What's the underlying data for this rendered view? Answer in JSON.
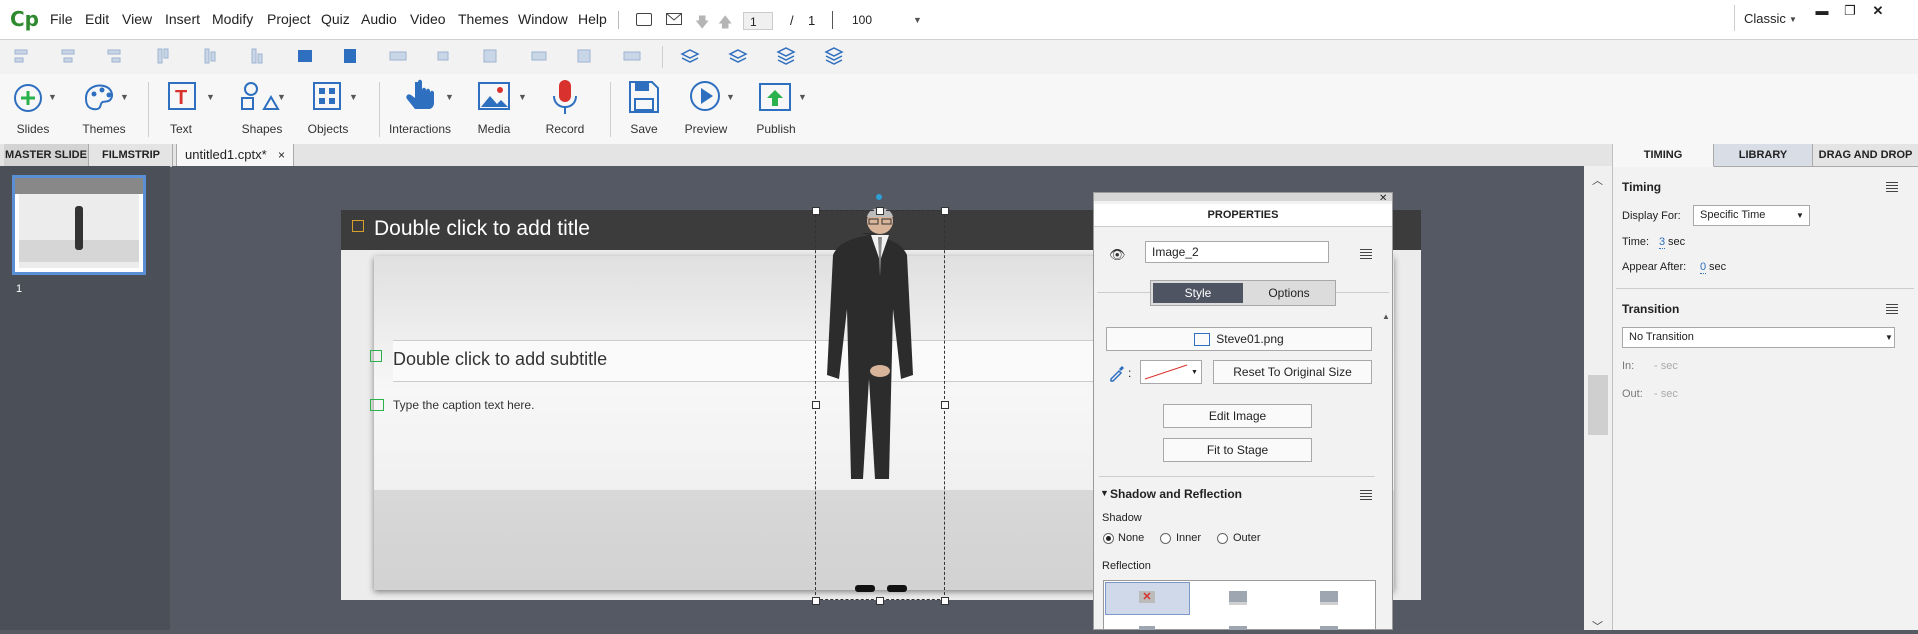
{
  "app": {
    "logo": "Cp"
  },
  "menus": [
    "File",
    "Edit",
    "View",
    "Insert",
    "Modify",
    "Project",
    "Quiz",
    "Audio",
    "Video",
    "Themes",
    "Window",
    "Help"
  ],
  "nav": {
    "current_page": "1",
    "separator": "/",
    "total_pages": "1",
    "zoom": "100"
  },
  "workspace": {
    "mode": "Classic"
  },
  "ribbon": {
    "slides": "Slides",
    "themes": "Themes",
    "text": "Text",
    "shapes": "Shapes",
    "objects": "Objects",
    "interactions": "Interactions",
    "media": "Media",
    "record": "Record",
    "save": "Save",
    "preview": "Preview",
    "publish": "Publish"
  },
  "tabs": {
    "master_slide": "MASTER SLIDE",
    "filmstrip": "FILMSTRIP",
    "doc": "untitled1.cptx*",
    "close": "×"
  },
  "filmstrip": {
    "slide_number": "1"
  },
  "slide": {
    "title_placeholder": "Double click to add title",
    "subtitle_placeholder": "Double click to add subtitle",
    "caption_text": "Type the caption text here."
  },
  "properties": {
    "header": "PROPERTIES",
    "name": "Image_2",
    "style_tab": "Style",
    "options_tab": "Options",
    "image_file": "Steve01.png",
    "reset_button": "Reset To Original Size",
    "edit_image": "Edit Image",
    "fit_to_stage": "Fit to Stage",
    "shadow_section": "Shadow and Reflection",
    "shadow_label": "Shadow",
    "shadow_options": [
      "None",
      "Inner",
      "Outer"
    ],
    "shadow_selected": "None",
    "reflection_label": "Reflection"
  },
  "right_tabs": {
    "timing": "TIMING",
    "library": "LIBRARY",
    "drag_drop": "DRAG AND DROP"
  },
  "timing": {
    "header": "Timing",
    "display_for_label": "Display For:",
    "display_for_value": "Specific Time",
    "time_label": "Time:",
    "time_value": "3",
    "time_unit": "sec",
    "appear_after_label": "Appear After:",
    "appear_after_value": "0",
    "appear_after_unit": "sec",
    "transition_header": "Transition",
    "transition_value": "No Transition",
    "in_label": "In:",
    "in_value": "- sec",
    "out_label": "Out:",
    "out_value": "- sec"
  },
  "colors": {
    "accent": "#2e6fbf",
    "logo_green": "#2f8a2f",
    "selection": "#5a8fd6"
  }
}
